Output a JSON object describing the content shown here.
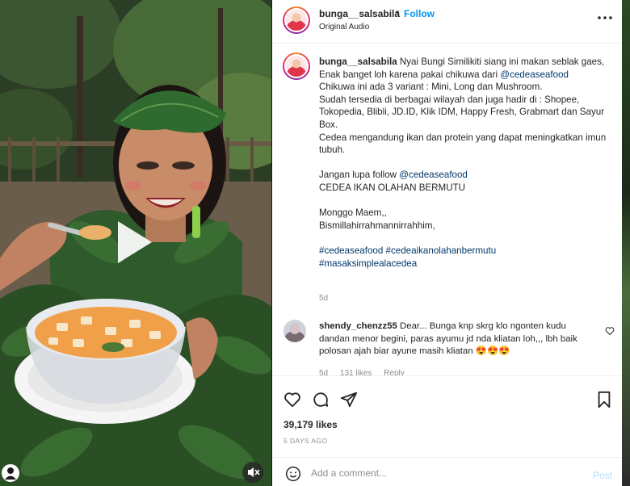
{
  "post": {
    "username": "bunga__salsabila",
    "dot": "•",
    "follow_label": "Follow",
    "audio_label": "Original Audio",
    "more_icon": "more-horizontal-icon"
  },
  "caption": {
    "username": "bunga__salsabila",
    "text_1": " Nyai Bungi Similikiti siang ini makan seblak gaes,\nEnak banget loh karena pakai chikuwa dari ",
    "mention_1": "@cedeaseafood",
    "text_2": "\nChikuwa ini ada 3 variant : Mini, Long dan Mushroom.\nSudah tersedia di berbagai wilayah dan juga hadir di : Shopee, Tokopedia, Blibli, JD.ID, Klik IDM, Happy Fresh, Grabmart dan Sayur Box.\nCedea mengandung ikan dan protein yang dapat meningkatkan imun tubuh.\n\nJangan lupa follow ",
    "mention_2": "@cedeaseafood",
    "text_3": "\nCEDEA IKAN OLAHAN BERMUTU\n\nMonggo Maem,,\nBismillahirrahmannirrahhim,\n\n",
    "hashtags": "#cedeaseafood #cedeaikanolahanbermutu\n#masaksimplealacedea",
    "time": "5d"
  },
  "comment": {
    "username": "shendy_chenzz55",
    "text": " Dear... Bunga knp skrg klo ngonten kudu dandan menor begini, paras ayumu jd nda kliatan loh,,, lbh baik polosan ajah biar ayune masih kliatan ",
    "emojis": "😍😍😍",
    "time": "5d",
    "likes": "131 likes",
    "reply_label": "Reply"
  },
  "actions": {
    "icons": [
      "heart-icon",
      "comment-icon",
      "share-icon",
      "bookmark-icon"
    ],
    "likes_count": "39,179 likes",
    "posted_ago": "5 DAYS AGO"
  },
  "add_comment": {
    "placeholder": "Add a comment...",
    "post_label": "Post"
  },
  "colors": {
    "link_blue": "#00376b",
    "follow_blue": "#0095f6",
    "post_disabled": "#b2dffc",
    "muted_text": "#8e8e8e"
  }
}
